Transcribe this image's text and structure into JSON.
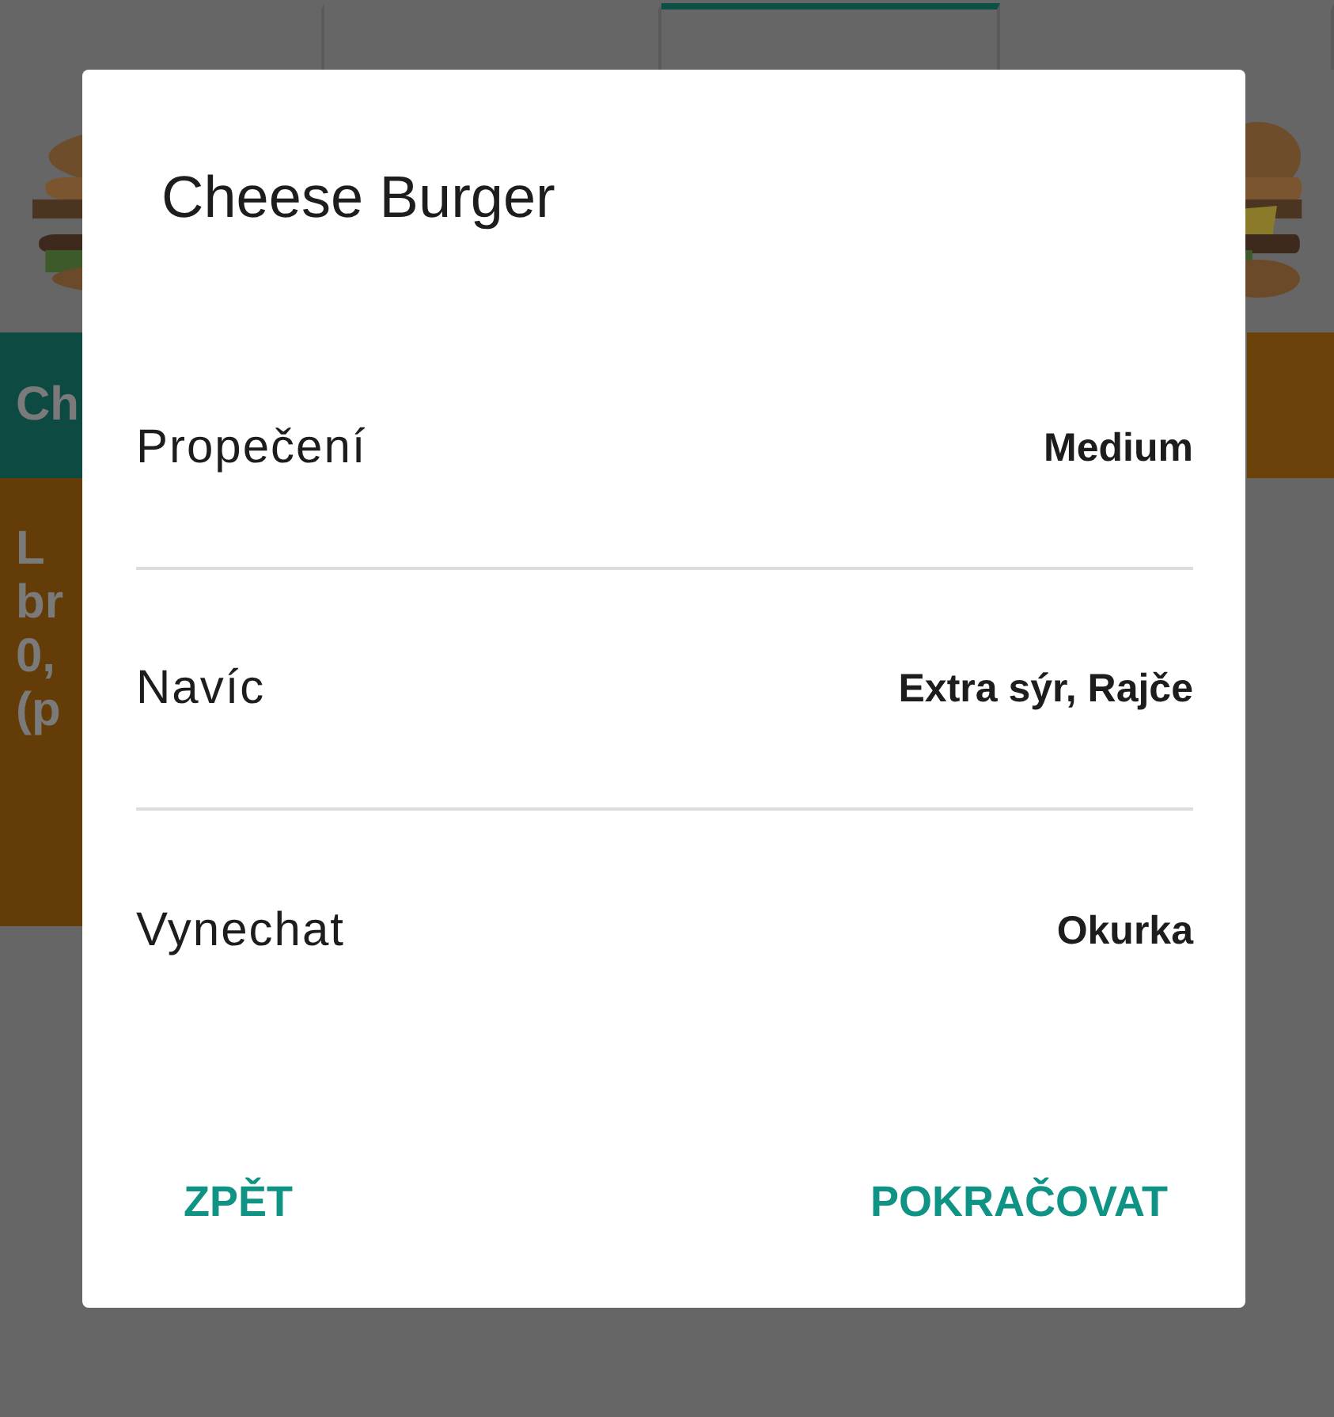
{
  "tabs": [
    {
      "selected": false
    },
    {
      "selected": false
    },
    {
      "selected": true
    },
    {
      "selected": false
    }
  ],
  "background_cards": [
    {
      "heading": "Ch",
      "lines": [
        "L",
        "br",
        "0,",
        "(p"
      ]
    }
  ],
  "dialog": {
    "title": "Cheese Burger",
    "options": [
      {
        "label": "Propečení",
        "value": "Medium"
      },
      {
        "label": "Navíc",
        "value": "Extra sýr, Rajče"
      },
      {
        "label": "Vynechat",
        "value": "Okurka"
      }
    ],
    "buttons": [
      {
        "label": "ZPĚT"
      },
      {
        "label": "POKRAČOVAT"
      }
    ]
  }
}
